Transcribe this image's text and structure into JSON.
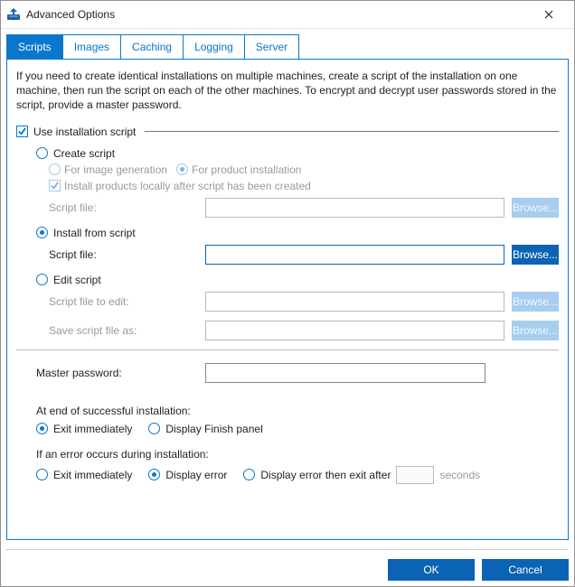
{
  "window": {
    "title": "Advanced Options"
  },
  "tabs": {
    "scripts": "Scripts",
    "images": "Images",
    "caching": "Caching",
    "logging": "Logging",
    "server": "Server"
  },
  "intro": "If you need to create identical installations on multiple machines, create a script of the installation on one machine, then run the script on each of the other machines. To encrypt and decrypt user passwords stored in the script, provide a master password.",
  "group": {
    "use_installation_script": "Use installation script",
    "create": {
      "label": "Create script",
      "for_image_generation": "For image generation",
      "for_product_installation": "For product installation",
      "install_locally": "Install products locally after script has been created",
      "script_file_label": "Script file:",
      "browse": "Browse..."
    },
    "install": {
      "label": "Install from script",
      "script_file_label": "Script file:",
      "browse": "Browse..."
    },
    "edit": {
      "label": "Edit script",
      "file_to_edit_label": "Script file to edit:",
      "save_as_label": "Save script file as:",
      "browse1": "Browse...",
      "browse2": "Browse..."
    },
    "master_password_label": "Master password:"
  },
  "success": {
    "heading": "At end of successful installation:",
    "exit_immediately": "Exit immediately",
    "display_finish": "Display Finish panel"
  },
  "error": {
    "heading": "If an error occurs during installation:",
    "exit_immediately": "Exit immediately",
    "display_error": "Display error",
    "display_error_then_exit": "Display error then exit after",
    "seconds": "seconds"
  },
  "buttons": {
    "ok": "OK",
    "cancel": "Cancel"
  }
}
